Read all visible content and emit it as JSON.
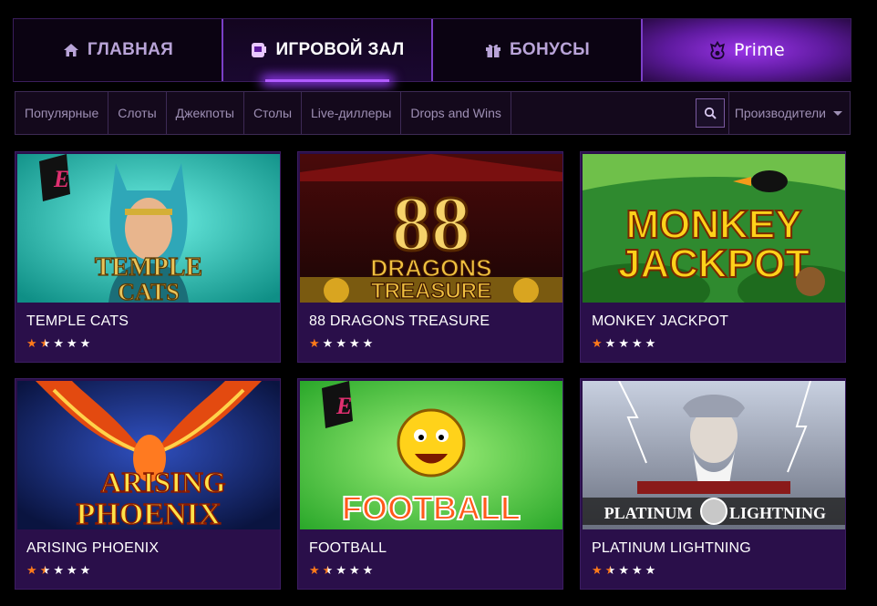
{
  "nav": {
    "home_label": "ГЛАВНАЯ",
    "hall_label": "ИГРОВОЙ ЗАЛ",
    "bonus_label": "БОНУСЫ",
    "prime_label": "Prime"
  },
  "filters": {
    "tabs": [
      "Популярные",
      "Слоты",
      "Джекпоты",
      "Столы",
      "Live-диллеры",
      "Drops and Wins"
    ],
    "providers_label": "Производители"
  },
  "games": [
    {
      "title": "TEMPLE CATS",
      "rating": 1.5,
      "art_text": [
        "TEMPLE",
        "CATS"
      ]
    },
    {
      "title": "88 DRAGONS TREASURE",
      "rating": 1,
      "art_text": [
        "DRAGONS",
        "TREASURE"
      ],
      "art_big": "88"
    },
    {
      "title": "MONKEY JACKPOT",
      "rating": 1,
      "art_text": [
        "MONKEY",
        "JACKPOT"
      ]
    },
    {
      "title": "ARISING PHOENIX",
      "rating": 1.5,
      "art_text": [
        "ARISING",
        "PHOENIX"
      ]
    },
    {
      "title": "FOOTBALL",
      "rating": 1.5,
      "art_text": [
        "FOOTBALL"
      ]
    },
    {
      "title": "PLATINUM LIGHTNING",
      "rating": 1.5,
      "art_text": [
        "PLATINUM",
        "LIGHTNING"
      ]
    }
  ],
  "colors": {
    "accent": "#9a35e8",
    "star_on": "#ff7a1a",
    "card_bg": "#2a0f4a"
  }
}
